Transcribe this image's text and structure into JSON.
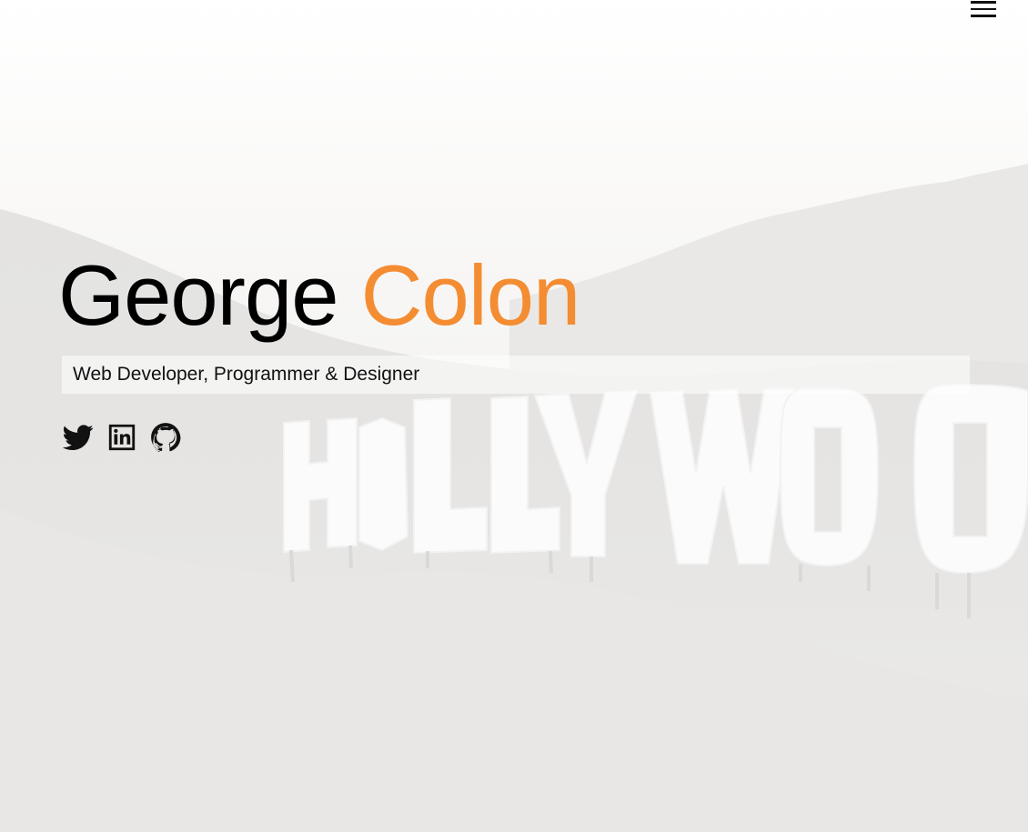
{
  "hero": {
    "first_name": "George",
    "last_name": "Colon",
    "tagline": "Web Developer, Programmer & Designer",
    "accent_color": "#f48c32",
    "background_image": "faded Hollywood sign hillside photo",
    "background_sign_letters": "HOLLYWOO"
  },
  "nav": {
    "menu_icon": "hamburger-menu-icon"
  },
  "social": [
    {
      "icon": "twitter-icon"
    },
    {
      "icon": "linkedin-icon"
    },
    {
      "icon": "github-icon"
    }
  ]
}
